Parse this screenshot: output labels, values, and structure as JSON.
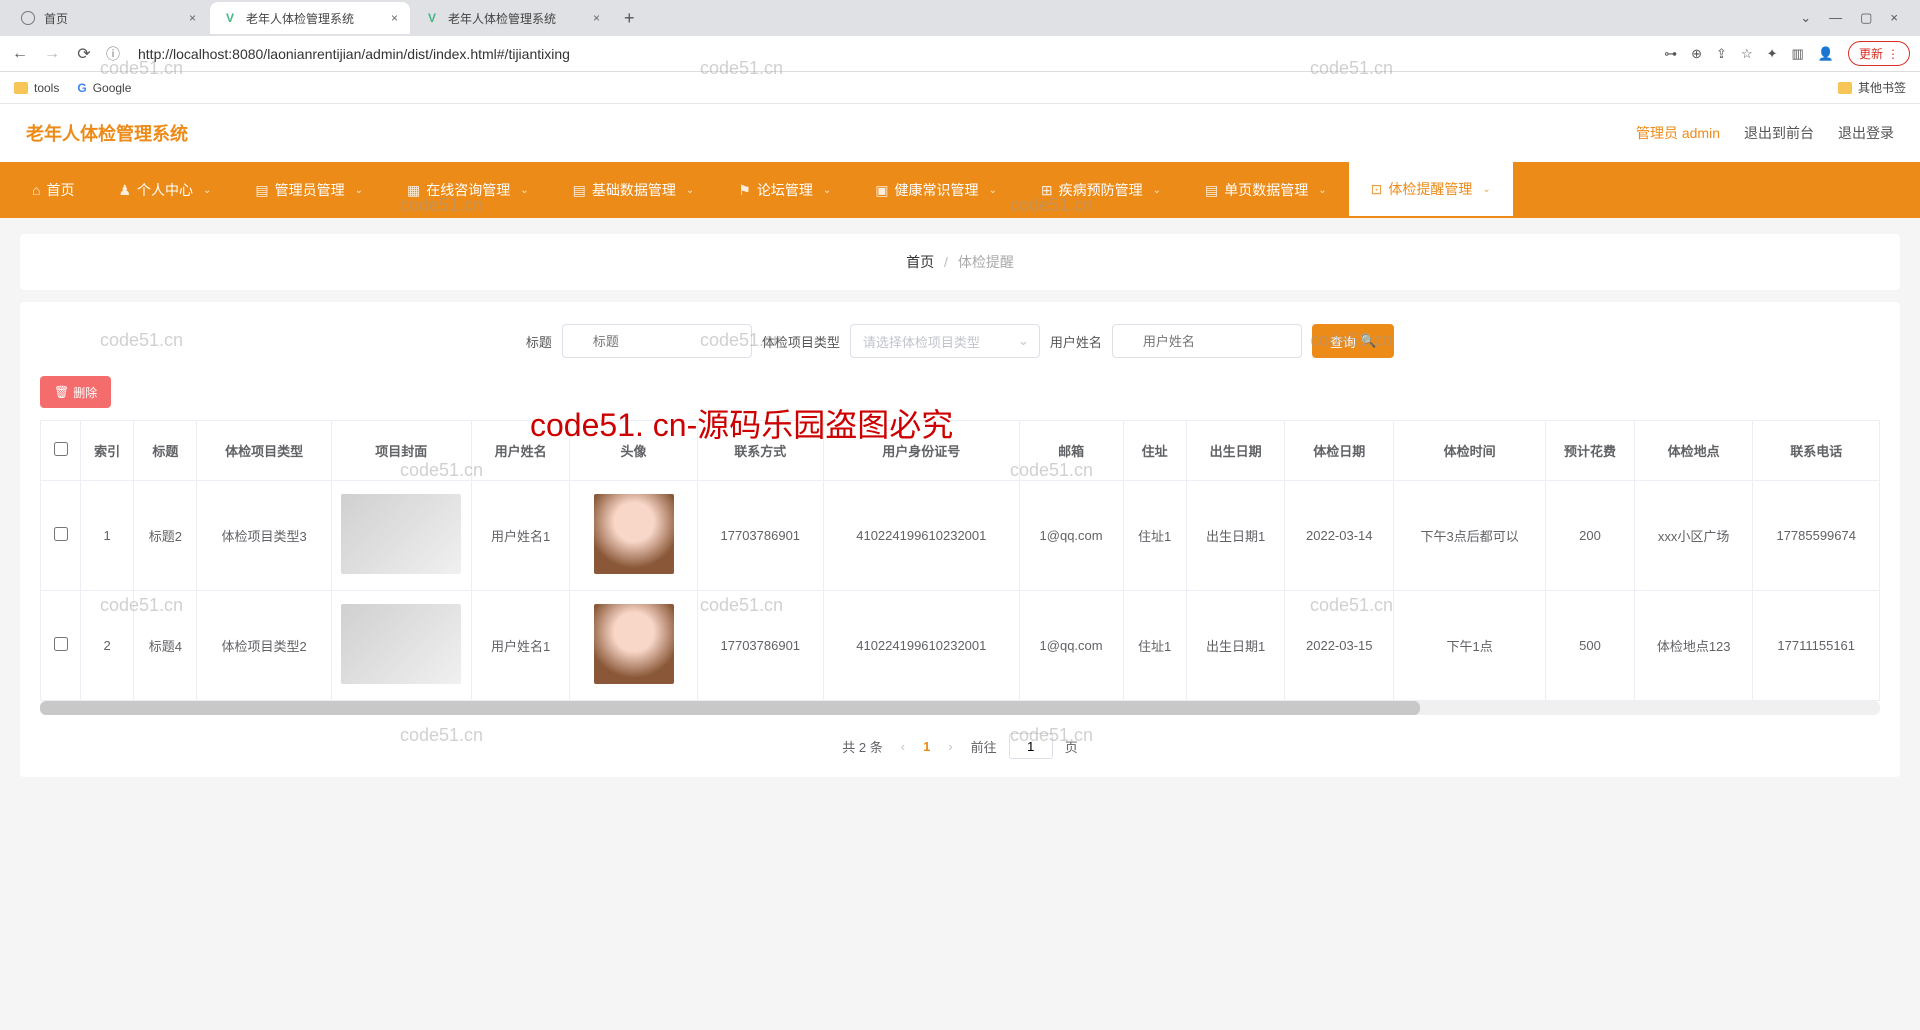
{
  "browser": {
    "tabs": [
      {
        "title": "首页",
        "icon": "globe"
      },
      {
        "title": "老年人体检管理系统",
        "icon": "vue"
      },
      {
        "title": "老年人体检管理系统",
        "icon": "vue"
      }
    ],
    "url": "http://localhost:8080/laonianrentijian/admin/dist/index.html#/tijiantixing",
    "update_label": "更新",
    "bookmarks": {
      "tools": "tools",
      "google": "Google",
      "other": "其他书签"
    }
  },
  "header": {
    "app_title": "老年人体检管理系统",
    "admin": "管理员 admin",
    "to_front": "退出到前台",
    "logout": "退出登录"
  },
  "nav": [
    {
      "label": "首页"
    },
    {
      "label": "个人中心"
    },
    {
      "label": "管理员管理"
    },
    {
      "label": "在线咨询管理"
    },
    {
      "label": "基础数据管理"
    },
    {
      "label": "论坛管理"
    },
    {
      "label": "健康常识管理"
    },
    {
      "label": "疾病预防管理"
    },
    {
      "label": "单页数据管理"
    },
    {
      "label": "体检提醒管理"
    }
  ],
  "breadcrumb": {
    "home": "首页",
    "current": "体检提醒"
  },
  "search": {
    "title_label": "标题",
    "title_placeholder": "标题",
    "type_label": "体检项目类型",
    "type_placeholder": "请选择体检项目类型",
    "user_label": "用户姓名",
    "user_placeholder": "用户姓名",
    "query_label": "查询"
  },
  "actions": {
    "delete": "删除"
  },
  "table": {
    "headers": [
      "",
      "索引",
      "标题",
      "体检项目类型",
      "项目封面",
      "用户姓名",
      "头像",
      "联系方式",
      "用户身份证号",
      "邮箱",
      "住址",
      "出生日期",
      "体检日期",
      "体检时间",
      "预计花费",
      "体检地点",
      "联系电话"
    ],
    "rows": [
      {
        "index": "1",
        "title": "标题2",
        "type": "体检项目类型3",
        "user": "用户姓名1",
        "phone": "17703786901",
        "idcard": "410224199610232001",
        "email": "1@qq.com",
        "addr": "住址1",
        "birth": "出生日期1",
        "date": "2022-03-14",
        "time": "下午3点后都可以",
        "cost": "200",
        "place": "xxx小区广场",
        "tel": "17785599674"
      },
      {
        "index": "2",
        "title": "标题4",
        "type": "体检项目类型2",
        "user": "用户姓名1",
        "phone": "17703786901",
        "idcard": "410224199610232001",
        "email": "1@qq.com",
        "addr": "住址1",
        "birth": "出生日期1",
        "date": "2022-03-15",
        "time": "下午1点",
        "cost": "500",
        "place": "体检地点123",
        "tel": "17711155161"
      }
    ]
  },
  "pager": {
    "total": "共 2 条",
    "goto": "前往",
    "page_value": "1",
    "page_suffix": "页",
    "current": "1"
  },
  "watermark": {
    "text": "code51.cn",
    "banner": "code51. cn-源码乐园盗图必究"
  }
}
